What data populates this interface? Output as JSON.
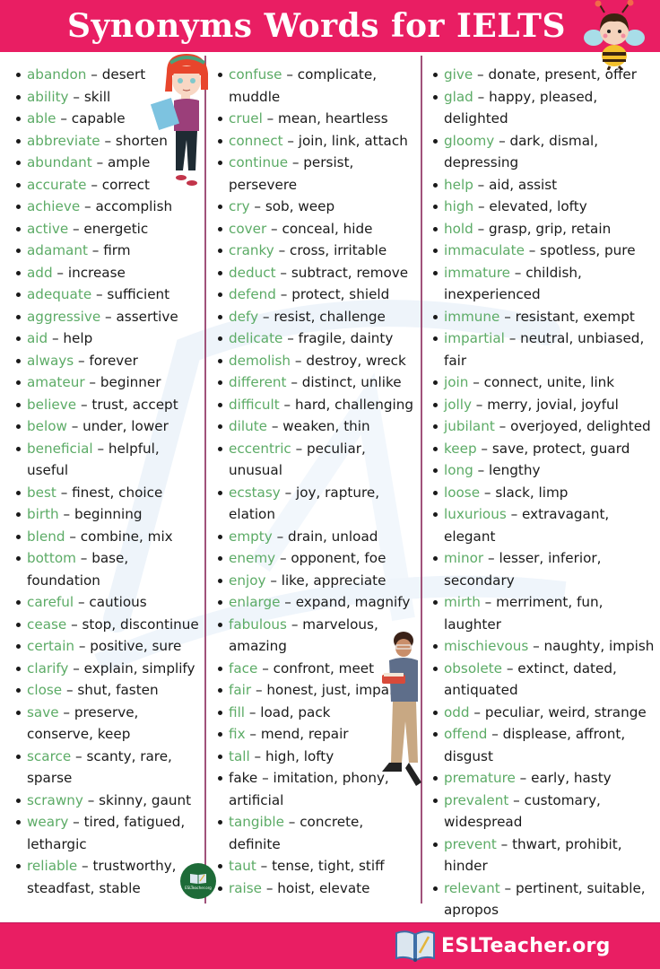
{
  "header": {
    "title": "Synonyms Words for IELTS"
  },
  "separator": "–",
  "columns": [
    [
      {
        "word": "abandon",
        "synonyms": "desert"
      },
      {
        "word": "ability",
        "synonyms": "skill"
      },
      {
        "word": "able",
        "synonyms": "capable"
      },
      {
        "word": "abbreviate",
        "synonyms": "shorten"
      },
      {
        "word": "abundant",
        "synonyms": "ample"
      },
      {
        "word": "accurate",
        "synonyms": "correct"
      },
      {
        "word": "achieve",
        "synonyms": "accomplish"
      },
      {
        "word": "active",
        "synonyms": "energetic"
      },
      {
        "word": "adamant",
        "synonyms": "firm"
      },
      {
        "word": "add",
        "synonyms": "increase"
      },
      {
        "word": "adequate",
        "synonyms": "sufficient"
      },
      {
        "word": "aggressive",
        "synonyms": "assertive"
      },
      {
        "word": "aid",
        "synonyms": "help"
      },
      {
        "word": "always",
        "synonyms": "forever"
      },
      {
        "word": "amateur",
        "synonyms": "beginner"
      },
      {
        "word": "believe",
        "synonyms": "trust, accept"
      },
      {
        "word": "below",
        "synonyms": "under, lower"
      },
      {
        "word": "beneficial",
        "synonyms": "helpful, useful"
      },
      {
        "word": "best",
        "synonyms": "finest, choice"
      },
      {
        "word": "birth",
        "synonyms": "beginning"
      },
      {
        "word": "blend",
        "synonyms": "combine, mix"
      },
      {
        "word": "bottom",
        "synonyms": "base, foundation"
      },
      {
        "word": "careful",
        "synonyms": "cautious"
      },
      {
        "word": "cease",
        "synonyms": "stop, discontinue"
      },
      {
        "word": "certain",
        "synonyms": "positive, sure"
      },
      {
        "word": "clarify",
        "synonyms": "explain, simplify"
      },
      {
        "word": "close",
        "synonyms": "shut, fasten"
      },
      {
        "word": "save",
        "synonyms": "preserve, conserve, keep"
      },
      {
        "word": "scarce",
        "synonyms": "scanty, rare, sparse"
      },
      {
        "word": "scrawny",
        "synonyms": "skinny, gaunt"
      },
      {
        "word": "weary",
        "synonyms": "tired, fatigued, lethargic"
      },
      {
        "word": "reliable",
        "synonyms": "trustworthy, steadfast, stable"
      }
    ],
    [
      {
        "word": "confuse",
        "synonyms": "complicate, muddle"
      },
      {
        "word": "cruel",
        "synonyms": "mean, heartless"
      },
      {
        "word": "connect",
        "synonyms": "join, link, attach"
      },
      {
        "word": "continue",
        "synonyms": "persist, persevere"
      },
      {
        "word": "cry",
        "synonyms": "sob, weep"
      },
      {
        "word": "cover",
        "synonyms": "conceal, hide"
      },
      {
        "word": "cranky",
        "synonyms": "cross, irritable"
      },
      {
        "word": "deduct",
        "synonyms": "subtract, remove"
      },
      {
        "word": "defend",
        "synonyms": "protect, shield"
      },
      {
        "word": "defy",
        "synonyms": "resist, challenge"
      },
      {
        "word": "delicate",
        "synonyms": "fragile, dainty"
      },
      {
        "word": "demolish",
        "synonyms": "destroy, wreck"
      },
      {
        "word": "different",
        "synonyms": "distinct, unlike"
      },
      {
        "word": "difficult",
        "synonyms": "hard, challenging"
      },
      {
        "word": "dilute",
        "synonyms": "weaken, thin"
      },
      {
        "word": "eccentric",
        "synonyms": "peculiar, unusual"
      },
      {
        "word": "ecstasy",
        "synonyms": "joy, rapture, elation"
      },
      {
        "word": "empty",
        "synonyms": "drain, unload"
      },
      {
        "word": "enemy",
        "synonyms": "opponent, foe"
      },
      {
        "word": "enjoy",
        "synonyms": "like, appreciate"
      },
      {
        "word": "enlarge",
        "synonyms": "expand, magnify"
      },
      {
        "word": "fabulous",
        "synonyms": "marvelous, amazing"
      },
      {
        "word": "face",
        "synonyms": "confront, meet"
      },
      {
        "word": "fair",
        "synonyms": "honest, just, impartial"
      },
      {
        "word": "fill",
        "synonyms": "load, pack"
      },
      {
        "word": "fix",
        "synonyms": "mend, repair"
      },
      {
        "word": "tall",
        "synonyms": "high, lofty"
      },
      {
        "word": "fake",
        "synonyms": "imitation, phony, artificial",
        "plain": true
      },
      {
        "word": "tangible",
        "synonyms": "concrete, definite"
      },
      {
        "word": "taut",
        "synonyms": "tense, tight, stiff"
      },
      {
        "word": "raise",
        "synonyms": "hoist, elevate"
      }
    ],
    [
      {
        "word": "give",
        "synonyms": "donate, present, offer"
      },
      {
        "word": "glad",
        "synonyms": "happy, pleased, delighted"
      },
      {
        "word": "gloomy",
        "synonyms": "dark, dismal, depressing"
      },
      {
        "word": "help",
        "synonyms": "aid, assist"
      },
      {
        "word": "high",
        "synonyms": "elevated, lofty"
      },
      {
        "word": "hold",
        "synonyms": "grasp, grip, retain"
      },
      {
        "word": "immaculate",
        "synonyms": "spotless, pure"
      },
      {
        "word": "immature",
        "synonyms": "childish, inexperienced"
      },
      {
        "word": "immune",
        "synonyms": "resistant, exempt"
      },
      {
        "word": "impartial",
        "synonyms": "neutral, unbiased, fair"
      },
      {
        "word": "join",
        "synonyms": "connect, unite, link"
      },
      {
        "word": "jolly",
        "synonyms": "merry, jovial, joyful"
      },
      {
        "word": "jubilant",
        "synonyms": "overjoyed, delighted"
      },
      {
        "word": "keep",
        "synonyms": "save, protect, guard"
      },
      {
        "word": "long",
        "synonyms": "lengthy"
      },
      {
        "word": "loose",
        "synonyms": "slack, limp"
      },
      {
        "word": "luxurious",
        "synonyms": "extravagant, elegant"
      },
      {
        "word": "minor",
        "synonyms": "lesser, inferior, secondary"
      },
      {
        "word": "mirth",
        "synonyms": "merriment, fun, laughter"
      },
      {
        "word": "mischievous",
        "synonyms": "naughty, impish"
      },
      {
        "word": "obsolete",
        "synonyms": "extinct, dated, antiquated"
      },
      {
        "word": "odd",
        "synonyms": "peculiar, weird, strange"
      },
      {
        "word": "offend",
        "synonyms": "displease, affront, disgust"
      },
      {
        "word": "premature",
        "synonyms": "early, hasty"
      },
      {
        "word": "prevalent",
        "synonyms": "customary, widespread"
      },
      {
        "word": "prevent",
        "synonyms": "thwart, prohibit, hinder"
      },
      {
        "word": "relevant",
        "synonyms": "pertinent, suitable, apropos"
      }
    ]
  ],
  "badge": {
    "text": "ESLTeacher.org"
  },
  "footer": {
    "brand": "ESLTeacher.org"
  },
  "colors": {
    "brand_pink": "#e91e63",
    "word_green": "#5cab66",
    "divider": "#a0527a",
    "badge_green": "#1e6b38"
  }
}
